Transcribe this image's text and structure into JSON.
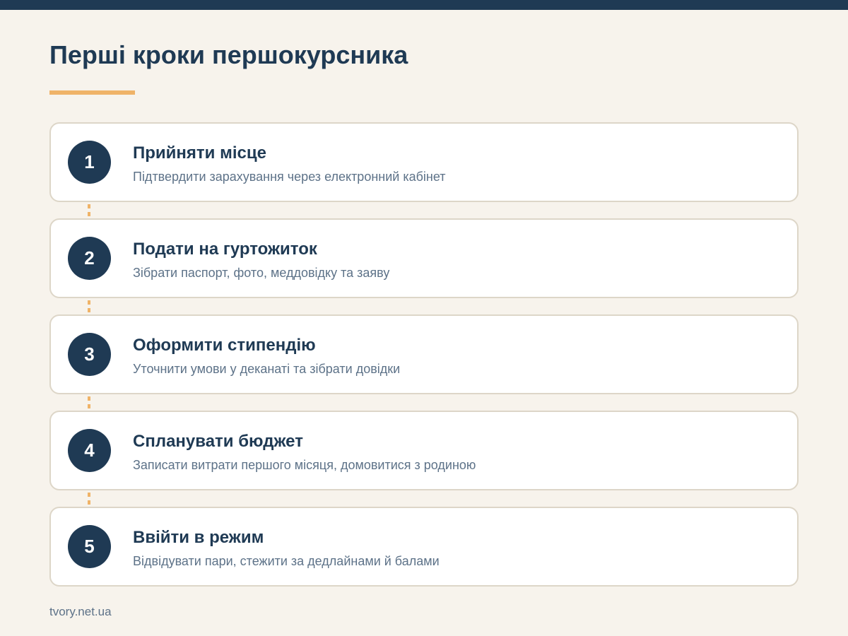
{
  "title": "Перші кроки першокурсника",
  "steps": [
    {
      "number": "1",
      "title": "Прийняти місце",
      "description": "Підтвердити зарахування через електронний кабінет"
    },
    {
      "number": "2",
      "title": "Подати на гуртожиток",
      "description": "Зібрати паспорт, фото, меддовідку та заяву"
    },
    {
      "number": "3",
      "title": "Оформити стипендію",
      "description": "Уточнити умови у деканаті та зібрати довідки"
    },
    {
      "number": "4",
      "title": "Спланувати бюджет",
      "description": "Записати витрати першого місяця, домовитися з родиною"
    },
    {
      "number": "5",
      "title": "Ввійти в режим",
      "description": "Відвідувати пари, стежити за дедлайнами й балами"
    }
  ],
  "footer": "tvory.net.ua",
  "colors": {
    "primary": "#1f3a54",
    "accent": "#efb368",
    "background": "#f7f3ec",
    "muted": "#5d7288"
  }
}
